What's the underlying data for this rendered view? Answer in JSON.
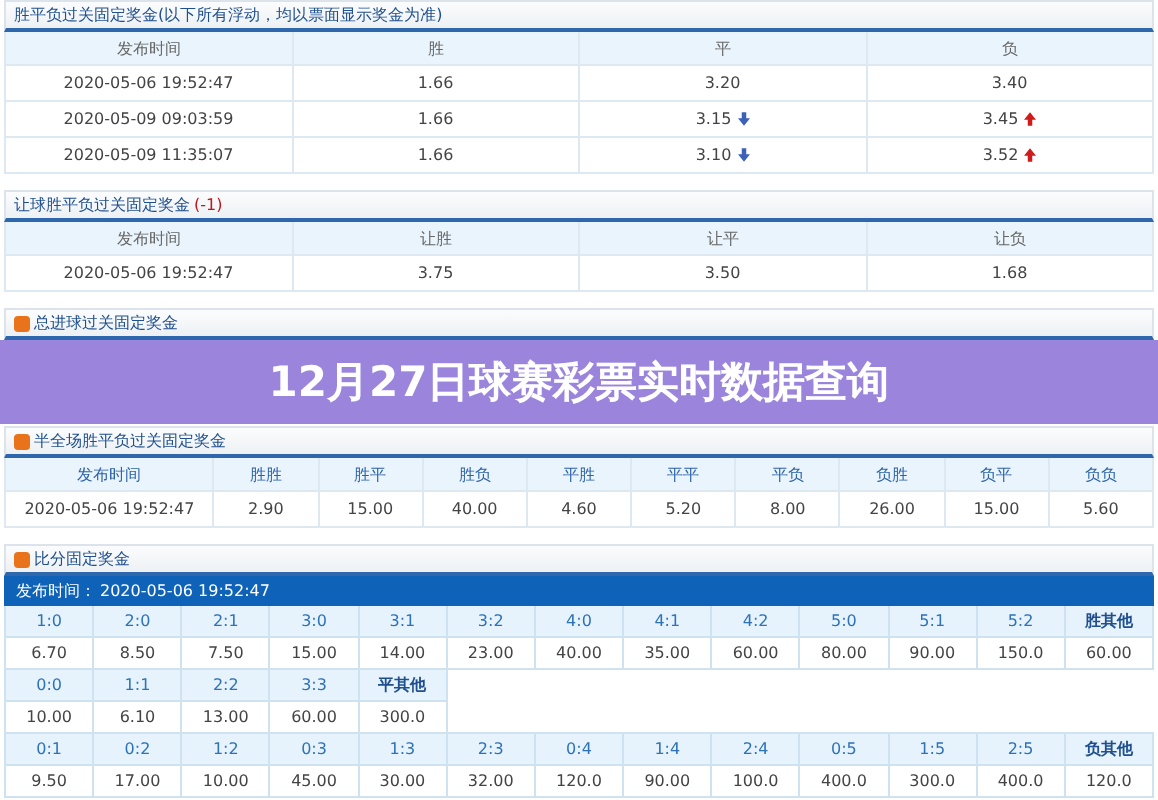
{
  "sections": [
    {
      "title": "胜平负过关固定奖金(以下所有浮动，均以票面显示奖金为准)",
      "icon": false,
      "columns": [
        "发布时间",
        "胜",
        "平",
        "负"
      ],
      "rows": [
        [
          "2020-05-06 19:52:47",
          "1.66",
          "3.20",
          "3.40"
        ],
        [
          "2020-05-09 09:03:59",
          "1.66",
          {
            "text": "3.15",
            "up": false
          },
          {
            "text": "3.45",
            "up": true
          }
        ],
        [
          "2020-05-09 11:35:07",
          "1.66",
          {
            "text": "3.10",
            "up": false
          },
          {
            "text": "3.52",
            "up": true
          }
        ]
      ]
    },
    {
      "title": "让球胜平负过关固定奖金",
      "handicap": "(-1)",
      "icon": false,
      "columns": [
        "发布时间",
        "让胜",
        "让平",
        "让负"
      ],
      "rows": [
        [
          "2020-05-06 19:52:47",
          "3.75",
          "3.50",
          "1.68"
        ]
      ]
    },
    {
      "title": "总进球过关固定奖金",
      "icon": true,
      "banner": {
        "title": "12月27日球赛彩票实时数据查询"
      }
    },
    {
      "title": "半全场胜平负过关固定奖金",
      "icon": true,
      "columns": [
        "发布时间",
        "胜胜",
        "胜平",
        "胜负",
        "平胜",
        "平平",
        "平负",
        "负胜",
        "负平",
        "负负"
      ],
      "rows": [
        [
          "2020-05-06 19:52:47",
          "2.90",
          "15.00",
          "40.00",
          "4.60",
          "5.20",
          "8.00",
          "26.00",
          "15.00",
          "5.60"
        ]
      ]
    }
  ],
  "score": {
    "title": "比分固定奖金",
    "publish_label": "发布时间：",
    "publish_time": "2020-05-06 19:52:47",
    "groups": [
      {
        "headers": [
          "1:0",
          "2:0",
          "2:1",
          "3:0",
          "3:1",
          "3:2",
          "4:0",
          "4:1",
          "4:2",
          "5:0",
          "5:1",
          "5:2",
          "胜其他"
        ],
        "values": [
          "6.70",
          "8.50",
          "7.50",
          "15.00",
          "14.00",
          "23.00",
          "40.00",
          "35.00",
          "60.00",
          "80.00",
          "90.00",
          "150.0",
          "60.00"
        ]
      },
      {
        "headers": [
          "0:0",
          "1:1",
          "2:2",
          "3:3",
          "平其他"
        ],
        "values": [
          "10.00",
          "6.10",
          "13.00",
          "60.00",
          "300.0"
        ]
      },
      {
        "headers": [
          "0:1",
          "0:2",
          "1:2",
          "0:3",
          "1:3",
          "2:3",
          "0:4",
          "1:4",
          "2:4",
          "0:5",
          "1:5",
          "2:5",
          "负其他"
        ],
        "values": [
          "9.50",
          "17.00",
          "10.00",
          "45.00",
          "30.00",
          "32.00",
          "120.0",
          "90.00",
          "100.0",
          "400.0",
          "300.0",
          "400.0",
          "120.0"
        ]
      }
    ]
  }
}
